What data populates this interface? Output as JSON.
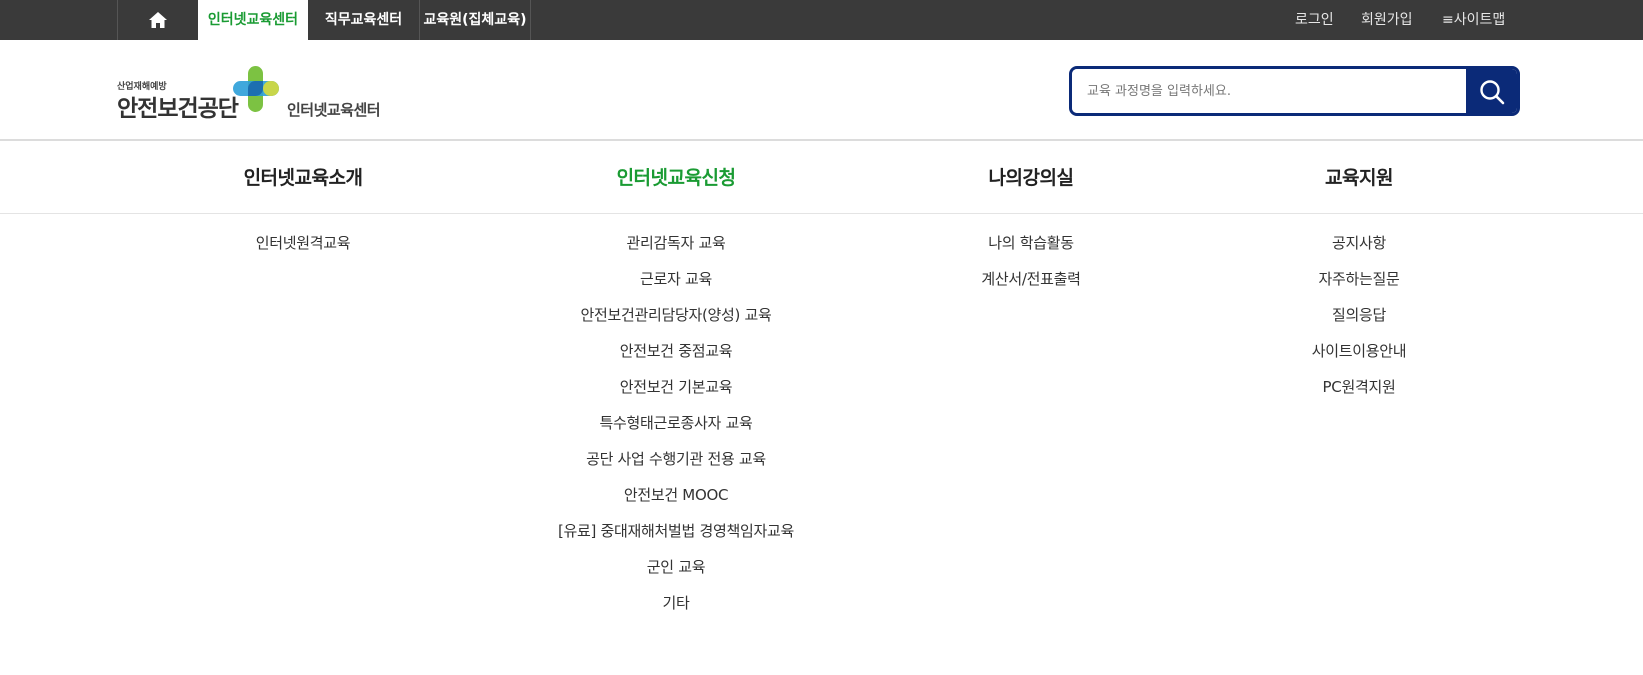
{
  "topbar": {
    "home_icon": "home-icon",
    "tabs": [
      {
        "label": "인터넷교육센터",
        "active": true
      },
      {
        "label": "직무교육센터"
      },
      {
        "label": "교육원(집체교육)"
      }
    ],
    "login": "로그인",
    "join": "회원가입",
    "sitemap": "≡사이트맵"
  },
  "header": {
    "logo_small": "산업재해예방",
    "logo_main": "안전보건공단",
    "logo_sub": "인터넷교육센터",
    "search_placeholder": "교육 과정명을 입력하세요.",
    "search_icon": "search-icon"
  },
  "menu": [
    {
      "title": "인터넷교육소개",
      "items": [
        "인터넷원격교육"
      ]
    },
    {
      "title": "인터넷교육신청",
      "active": true,
      "items": [
        "관리감독자 교육",
        "근로자 교육",
        "안전보건관리담당자(양성) 교육",
        "안전보건 중점교육",
        "안전보건 기본교육",
        "특수형태근로종사자 교육",
        "공단 사업 수행기관 전용 교육",
        "안전보건 MOOC",
        "[유료] 중대재해처벌법 경영책임자교육",
        "군인 교육",
        "기타"
      ]
    },
    {
      "title": "나의강의실",
      "items": [
        "나의 학습활동",
        "계산서/전표출력"
      ]
    },
    {
      "title": "교육지원",
      "items": [
        "공지사항",
        "자주하는질문",
        "질의응답",
        "사이트이용안내",
        "PC원격지원"
      ]
    }
  ],
  "colors": {
    "topbar": "#3a3a3a",
    "accent_green": "#1a9b33",
    "search_navy": "#0b2a78"
  }
}
